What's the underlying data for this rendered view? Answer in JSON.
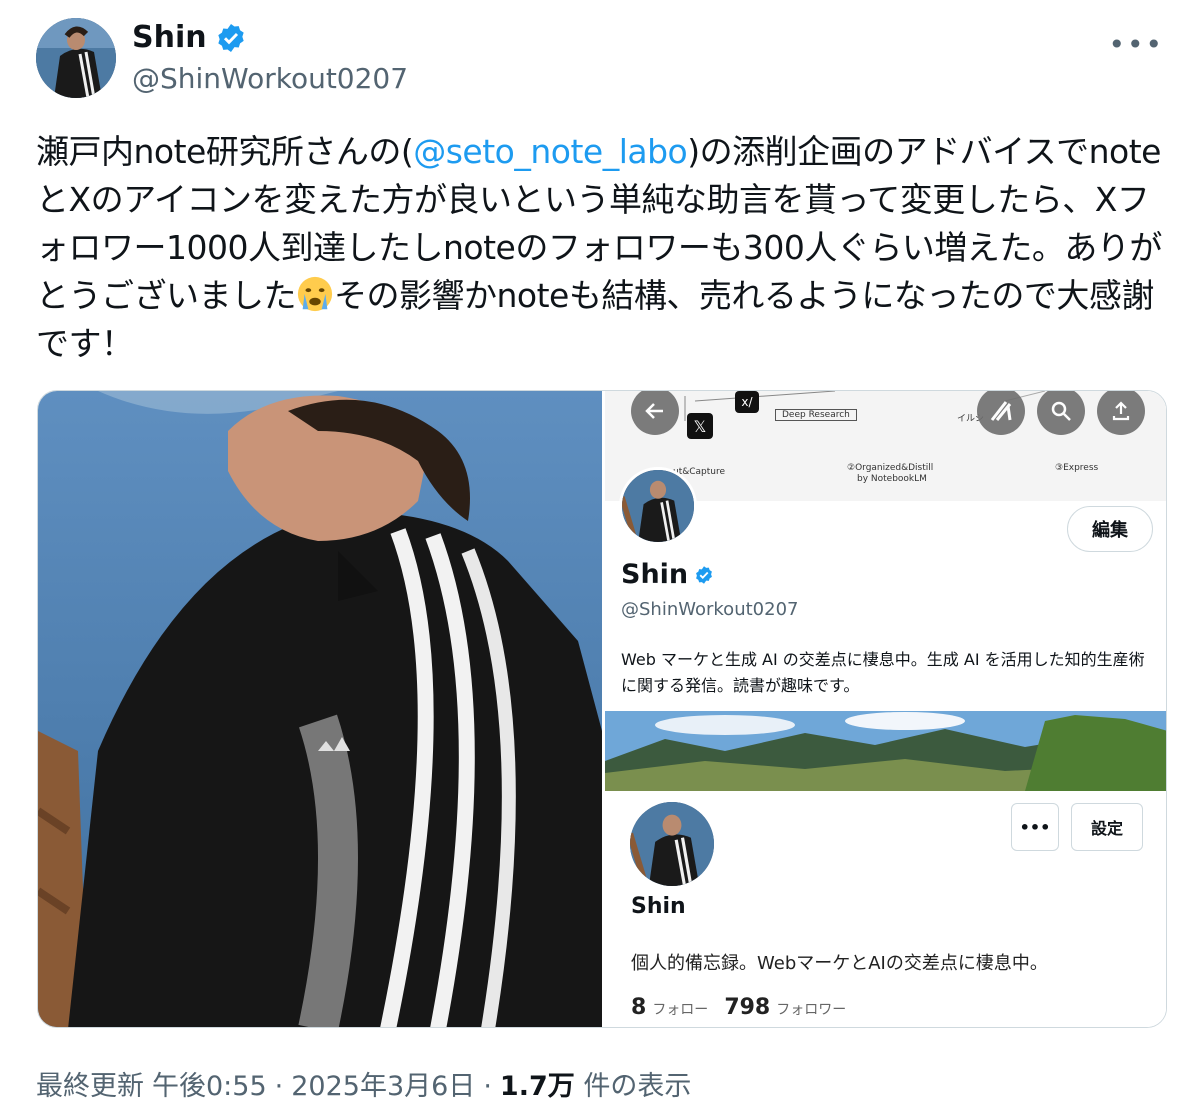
{
  "author": {
    "name": "Shin",
    "handle": "@ShinWorkout0207"
  },
  "colors": {
    "link": "#1d9bf0",
    "verified": "#1d9bf0",
    "muted": "#536471"
  },
  "tweet": {
    "text_before": "瀬戸内note研究所さんの(",
    "mention": "@seto_note_labo",
    "text_middle": ")の添削企画のアドバイスでnoteとXのアイコンを変えた方が良いという単純な助言を貰って変更したら、Xフォロワー1000人到達したしnoteのフォロワーも300人ぐらい増えた。ありがとうございました",
    "text_after": "その影響かnoteも結構、売れるようになったので大感謝です！"
  },
  "x_profile": {
    "name": "Shin",
    "handle": "@ShinWorkout0207",
    "bio": "Web マーケと生成 AI の交差点に棲息中。生成 AI を活用した知的生産術に関する発信。読書が趣味です。",
    "edit_label": "編集",
    "banner_labels": {
      "capture": "ut&Capture",
      "organized": "②Organized&Distill",
      "notebook": "by NotebookLM",
      "express": "③Express",
      "deep_research": "Deep Research",
      "small_jp": "イルシ"
    }
  },
  "note_profile": {
    "name": "Shin",
    "bio": "個人的備忘録。WebマーケとAIの交差点に棲息中。",
    "settings_label": "設定",
    "more_label": "•••",
    "following_count": "8",
    "following_label": "フォロー",
    "followers_count": "798",
    "followers_label": "フォロワー"
  },
  "meta": {
    "updated_label": "最終更新",
    "time": "午後0:55",
    "date": "2025年3月6日",
    "views": "1.7万",
    "views_label": "件の表示",
    "sep": "·"
  }
}
